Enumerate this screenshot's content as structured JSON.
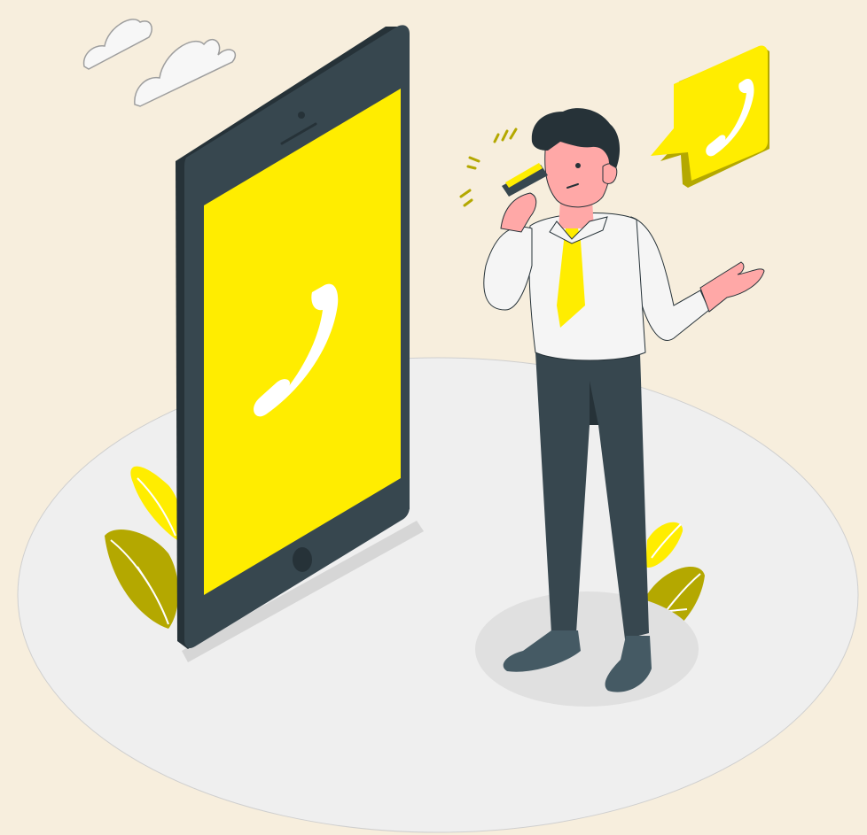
{
  "scene": {
    "subject": "phone-call-illustration",
    "colors": {
      "background": "#f7eedd",
      "floor": "#efefef",
      "accent_yellow": "#ffed00",
      "dark_grey": "#37474f",
      "olive": "#b4a800",
      "skin": "#ffa8a7",
      "shirt": "#f5f5f5"
    },
    "icons": [
      "cloud-icon",
      "phone-handset-icon",
      "chat-bubble-phone-icon",
      "plant-icon"
    ]
  }
}
